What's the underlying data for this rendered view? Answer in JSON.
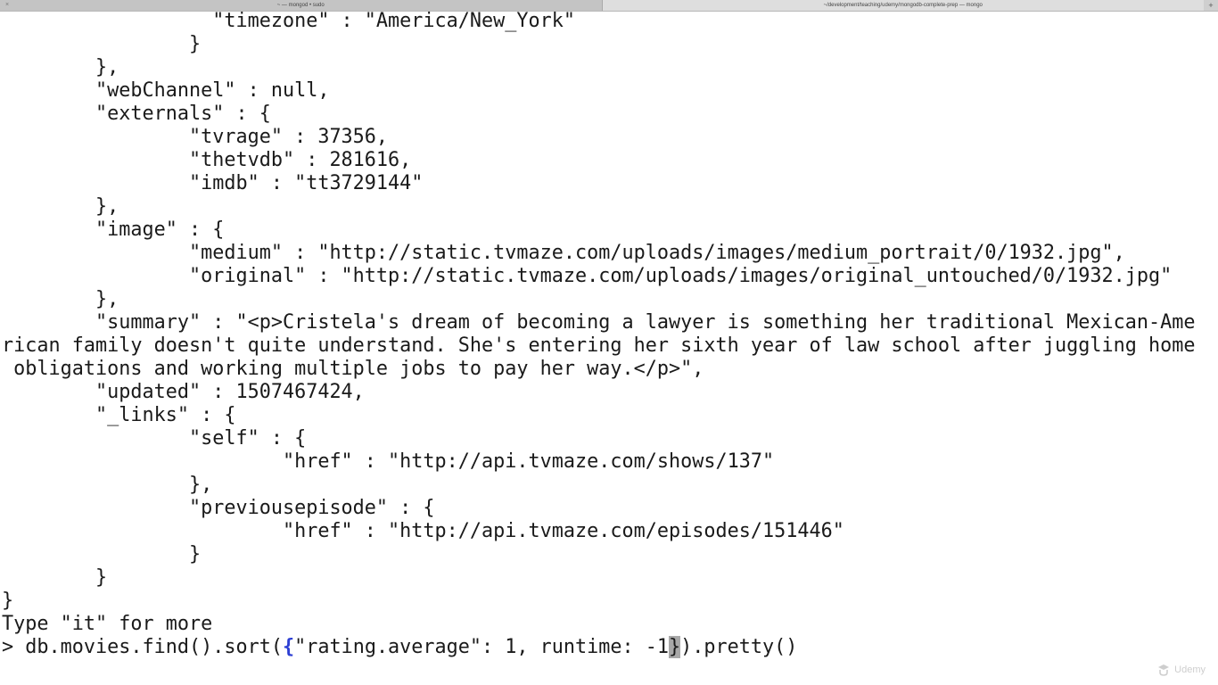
{
  "window": {
    "tabs": [
      {
        "label": "~ — mongod • sudo",
        "close_glyph": "×",
        "active": false
      },
      {
        "label": "~/development/teaching/udemy/mongodb-complete-prep — mongo",
        "close_glyph": "",
        "active": true
      }
    ],
    "new_tab_glyph": "+"
  },
  "terminal": {
    "output_lines": [
      "                  \"timezone\" : \"America/New_York\"",
      "                }",
      "        },",
      "        \"webChannel\" : null,",
      "        \"externals\" : {",
      "                \"tvrage\" : 37356,",
      "                \"thetvdb\" : 281616,",
      "                \"imdb\" : \"tt3729144\"",
      "        },",
      "        \"image\" : {",
      "                \"medium\" : \"http://static.tvmaze.com/uploads/images/medium_portrait/0/1932.jpg\",",
      "                \"original\" : \"http://static.tvmaze.com/uploads/images/original_untouched/0/1932.jpg\"",
      "        },",
      "        \"summary\" : \"<p>Cristela's dream of becoming a lawyer is something her traditional Mexican-Ame",
      "rican family doesn't quite understand. She's entering her sixth year of law school after juggling home",
      " obligations and working multiple jobs to pay her way.</p>\",",
      "        \"updated\" : 1507467424,",
      "        \"_links\" : {",
      "                \"self\" : {",
      "                        \"href\" : \"http://api.tvmaze.com/shows/137\"",
      "                },",
      "                \"previousepisode\" : {",
      "                        \"href\" : \"http://api.tvmaze.com/episodes/151446\"",
      "                }",
      "        }",
      "}",
      "Type \"it\" for more"
    ],
    "prompt": {
      "symbol": "> ",
      "command_before_brace": "db.movies.find().sort(",
      "open_brace": "{",
      "command_middle": "\"rating.average\": 1, runtime: -1",
      "cursor_char": "}",
      "command_after": ").pretty()"
    }
  },
  "watermark": {
    "icon": "udemy-logo-icon",
    "text": "Udemy"
  },
  "colors": {
    "background": "#ffffff",
    "text": "#1a1a1a",
    "brace_highlight": "#2d3fd3",
    "cursor": "#a8a8a8"
  }
}
